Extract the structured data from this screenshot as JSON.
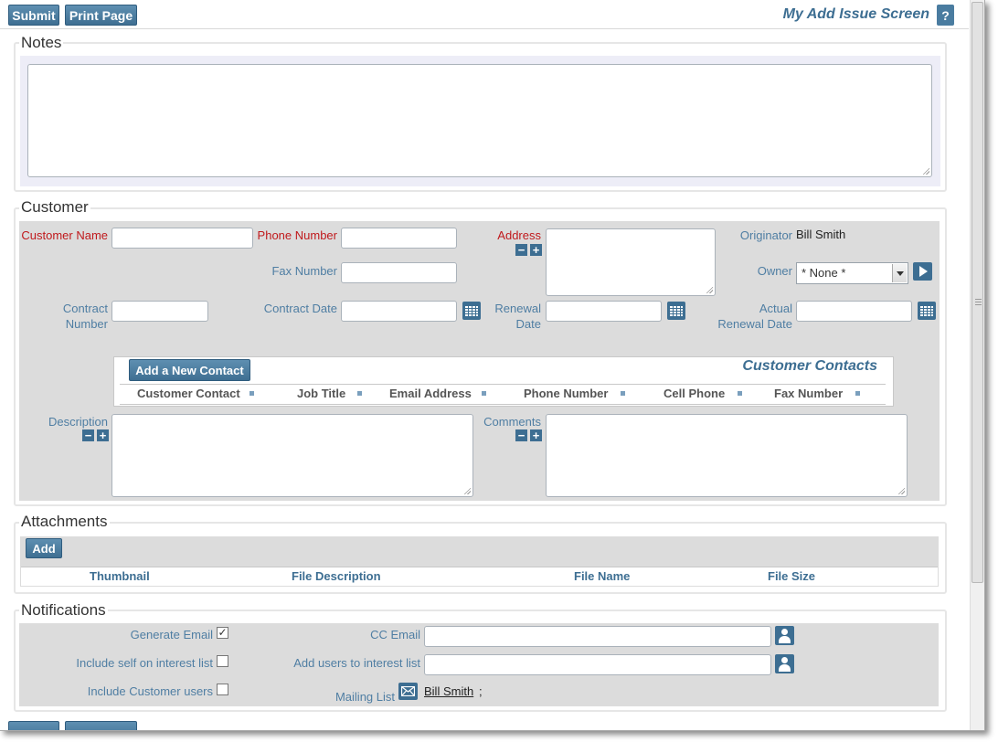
{
  "toolbar": {
    "submit_label": "Submit",
    "print_label": "Print Page",
    "screen_title": "My Add Issue Screen",
    "help_label": "?"
  },
  "notes": {
    "legend": "Notes"
  },
  "customer": {
    "legend": "Customer",
    "customer_name_label": "Customer Name",
    "phone_number_label": "Phone Number",
    "address_label": "Address",
    "originator_label": "Originator",
    "originator_value": "Bill Smith",
    "fax_number_label": "Fax Number",
    "owner_label": "Owner",
    "owner_value": "* None *",
    "contract_number_label_1": "Contract",
    "contract_number_label_2": "Number",
    "contract_date_label": "Contract Date",
    "renewal_date_label_1": "Renewal",
    "renewal_date_label_2": "Date",
    "actual_renewal_label_1": "Actual",
    "actual_renewal_label_2": "Renewal Date",
    "description_label": "Description",
    "comments_label": "Comments"
  },
  "contacts": {
    "add_button": "Add a New Contact",
    "title": "Customer Contacts",
    "columns": [
      "Customer Contact",
      "Job Title",
      "Email Address",
      "Phone Number",
      "Cell Phone",
      "Fax Number"
    ]
  },
  "attachments": {
    "legend": "Attachments",
    "add_button": "Add",
    "columns": [
      "Thumbnail",
      "File Description",
      "File Name",
      "File Size"
    ]
  },
  "notifications": {
    "legend": "Notifications",
    "generate_email_label": "Generate Email",
    "generate_email_checked": true,
    "include_self_label": "Include self on interest list",
    "include_customer_label": "Include Customer users",
    "cc_email_label": "CC Email",
    "add_users_label": "Add users to interest list",
    "mailing_list_label": "Mailing List",
    "mailing_list_user": "Bill Smith",
    "mailing_list_separator": ";"
  },
  "colors": {
    "accent": "#3d6e92",
    "label": "#4f7ea3",
    "required": "#c0191c",
    "panel": "#dcdcdc"
  },
  "icons": [
    "calendar-icon",
    "play-icon",
    "user-icon",
    "mail-icon",
    "collapse-icon",
    "expand-icon"
  ]
}
